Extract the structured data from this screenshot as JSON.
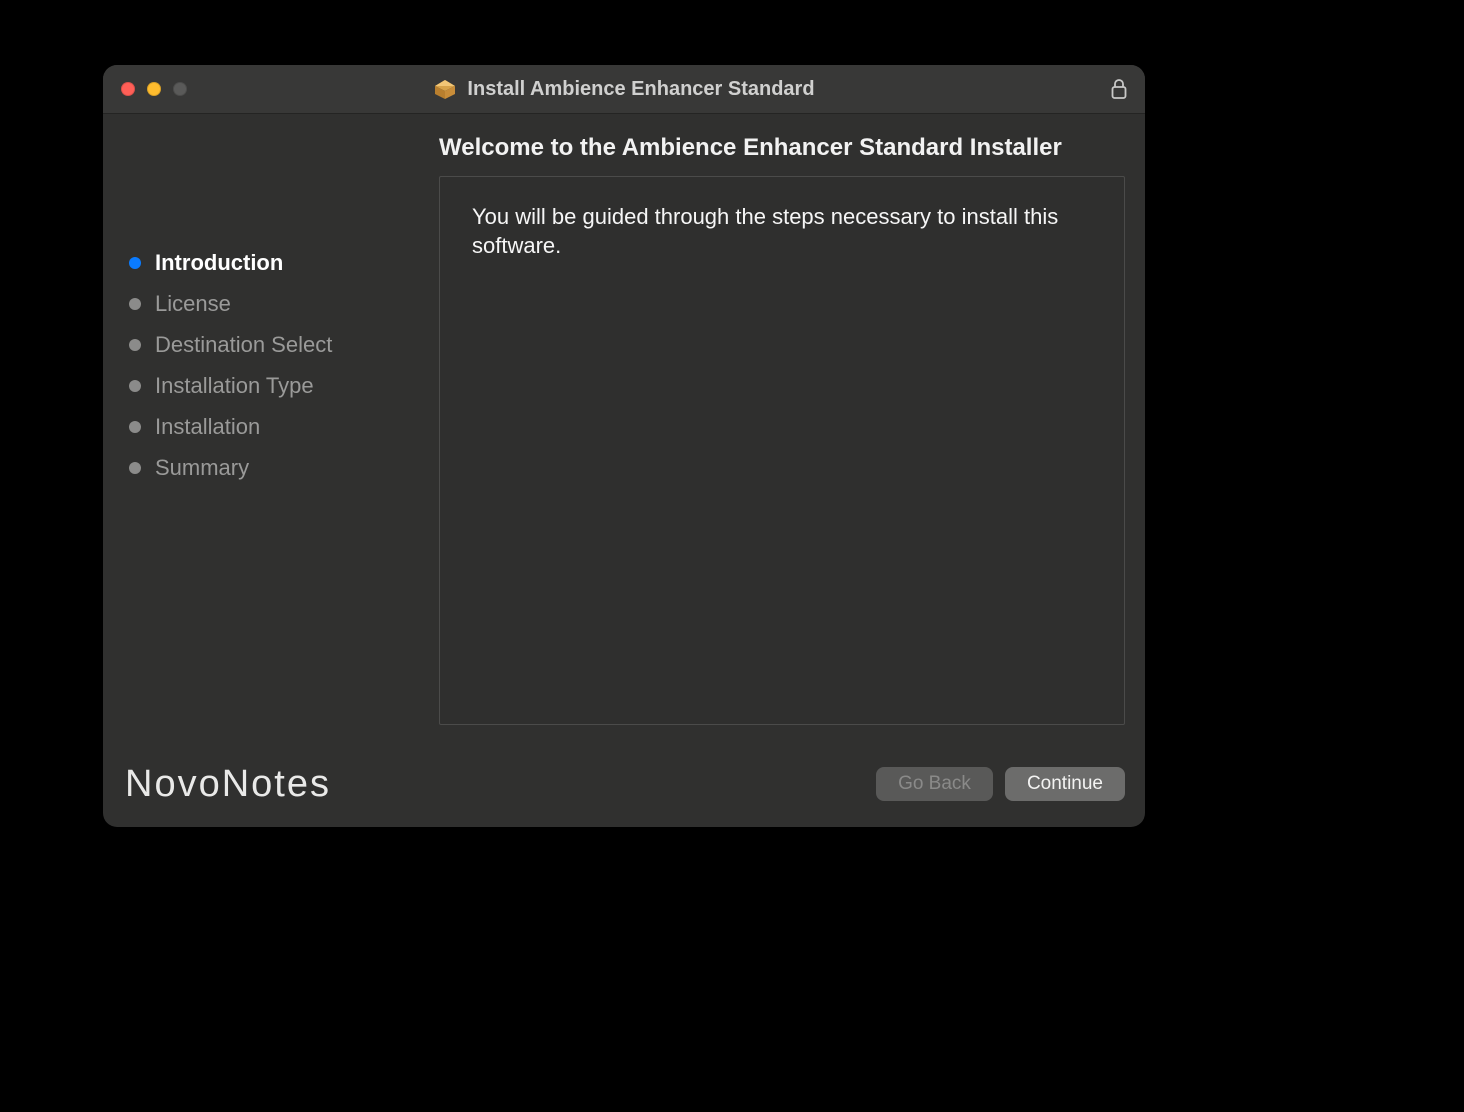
{
  "titlebar": {
    "title": "Install Ambience Enhancer Standard",
    "traffic": {
      "close": "close",
      "minimize": "minimize",
      "maximize": "maximize"
    },
    "lock": "locked"
  },
  "sidebar": {
    "steps": [
      {
        "label": "Introduction",
        "active": true
      },
      {
        "label": "License",
        "active": false
      },
      {
        "label": "Destination Select",
        "active": false
      },
      {
        "label": "Installation Type",
        "active": false
      },
      {
        "label": "Installation",
        "active": false
      },
      {
        "label": "Summary",
        "active": false
      }
    ]
  },
  "main": {
    "heading": "Welcome to the Ambience Enhancer Standard Installer",
    "body": "You will be guided through the steps necessary to install this software."
  },
  "footer": {
    "brand": "NovoNotes",
    "go_back": "Go Back",
    "continue": "Continue",
    "go_back_enabled": false
  }
}
